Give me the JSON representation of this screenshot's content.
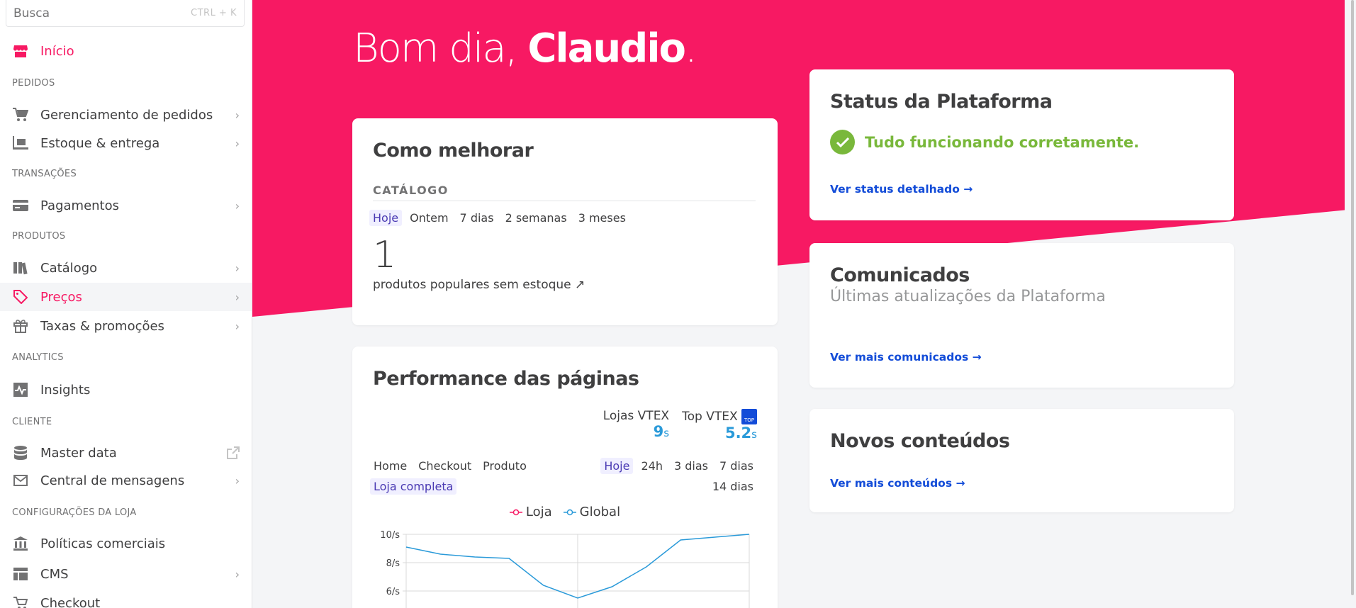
{
  "search": {
    "placeholder": "Busca",
    "shortcut": "CTRL + K"
  },
  "sidebar": {
    "home": {
      "label": "Início",
      "icon": "store-icon"
    },
    "sections": [
      {
        "title": "PEDIDOS"
      },
      {
        "title": "TRANSAÇÕES"
      },
      {
        "title": "PRODUTOS"
      },
      {
        "title": "ANALYTICS"
      },
      {
        "title": "CLIENTE"
      },
      {
        "title": "CONFIGURAÇÕES DA LOJA"
      }
    ],
    "items": [
      {
        "label": "Gerenciamento de pedidos",
        "icon": "cart-icon"
      },
      {
        "label": "Estoque & entrega",
        "icon": "forklift-icon"
      },
      {
        "label": "Pagamentos",
        "icon": "credit-card-icon"
      },
      {
        "label": "Catálogo",
        "icon": "catalog-icon"
      },
      {
        "label": "Preços",
        "icon": "price-tag-icon"
      },
      {
        "label": "Taxas & promoções",
        "icon": "gift-icon"
      },
      {
        "label": "Insights",
        "icon": "activity-icon"
      },
      {
        "label": "Master data",
        "icon": "database-icon"
      },
      {
        "label": "Central de mensagens",
        "icon": "mail-icon"
      },
      {
        "label": "Políticas comerciais",
        "icon": "bank-icon"
      },
      {
        "label": "CMS",
        "icon": "layout-icon"
      },
      {
        "label": "Checkout",
        "icon": "checkout-cart-icon"
      }
    ]
  },
  "main": {
    "greeting_prefix": "Bom dia,",
    "user_name": "Claudio",
    "greeting_suffix": ".",
    "hero_color": "#f71963"
  },
  "status_card": {
    "title": "Status da Plataforma",
    "message": "Tudo funcionando corretamente.",
    "link": "Ver status detalhado →",
    "ok_color": "#79b83b"
  },
  "communications_card": {
    "title": "Comunicados",
    "subtitle": "Últimas atualizações da Plataforma",
    "link": "Ver mais comunicados →"
  },
  "news_card": {
    "title": "Novos conteúdos",
    "link": "Ver mais conteúdos →"
  },
  "improve_card": {
    "title": "Como melhorar",
    "section": "CATÁLOGO",
    "periods": [
      "Hoje",
      "Ontem",
      "7 dias",
      "2 semanas",
      "3 meses"
    ],
    "selected_period": "Hoje",
    "count": "1",
    "description": "produtos populares sem estoque ↗"
  },
  "performance_card": {
    "title": "Performance das páginas",
    "benchmarks": [
      {
        "label": "Lojas VTEX",
        "value": "9",
        "unit": "s"
      },
      {
        "label": "Top VTEX",
        "value": "5.2",
        "unit": "s",
        "badge": "TOP"
      }
    ],
    "page_tabs": [
      "Home",
      "Checkout",
      "Produto",
      "Loja completa"
    ],
    "selected_page": "Loja completa",
    "range_tabs": [
      "Hoje",
      "24h",
      "3 dias",
      "7 dias",
      "14 dias"
    ],
    "selected_range": "Hoje"
  },
  "chart_data": {
    "type": "line",
    "legend": [
      "Loja",
      "Global"
    ],
    "y_ticks": [
      "10/s",
      "8/s",
      "6/s"
    ],
    "ylim": [
      5.5,
      10.5
    ],
    "series": [
      {
        "name": "Loja",
        "color": "#f71963",
        "values": []
      },
      {
        "name": "Global",
        "color": "#2a9ad9",
        "values": [
          9.1,
          8.6,
          8.4,
          8.3,
          6.4,
          5.5,
          6.3,
          7.7,
          9.6,
          9.8,
          10.0
        ]
      }
    ]
  }
}
